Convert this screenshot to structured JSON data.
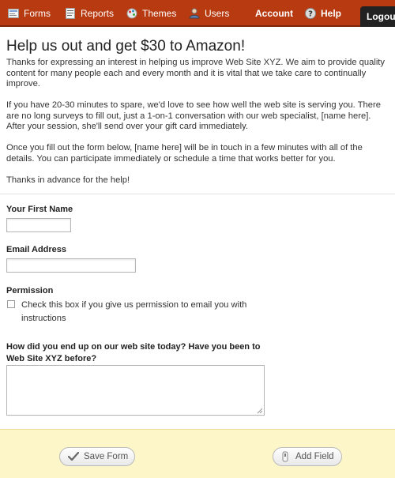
{
  "nav": {
    "forms": "Forms",
    "reports": "Reports",
    "themes": "Themes",
    "users": "Users",
    "account": "Account",
    "help": "Help",
    "logout": "Logout"
  },
  "intro": {
    "title": "Help us out and get $30 to Amazon!",
    "paragraphs": [
      "Thanks for expressing an interest in helping us improve Web Site XYZ. We aim to provide quality content for many people each and every month and it is vital that we take care to continually improve.",
      "If you have 20-30 minutes to spare, we'd love to see how well the web site is serving you. There are no long surveys to fill out, just a 1-on-1 conversation with our web specialist, [name here]. After your session, she'll send over your gift card immediately.",
      "Once you fill out the form below, [name here] will be in touch in a few minutes with all of the details. You can participate immediately or schedule a time that works better for you.",
      "Thanks in advance for the help!"
    ]
  },
  "form": {
    "first_name_label": "Your First Name",
    "first_name_value": "",
    "email_label": "Email Address",
    "email_value": "",
    "permission_label": "Permission",
    "permission_checkbox_text": "Check this box if you give us permission to email you with instructions",
    "permission_checked": false,
    "question_label": "How did you end up on our web site today? Have you been to Web Site XYZ before?",
    "question_value": ""
  },
  "footer": {
    "save_label": "Save Form",
    "add_field_label": "Add Field"
  },
  "colors": {
    "nav_bg": "#b83a10",
    "logout_bg": "#222222",
    "footer_bg": "#fdf6c8"
  }
}
